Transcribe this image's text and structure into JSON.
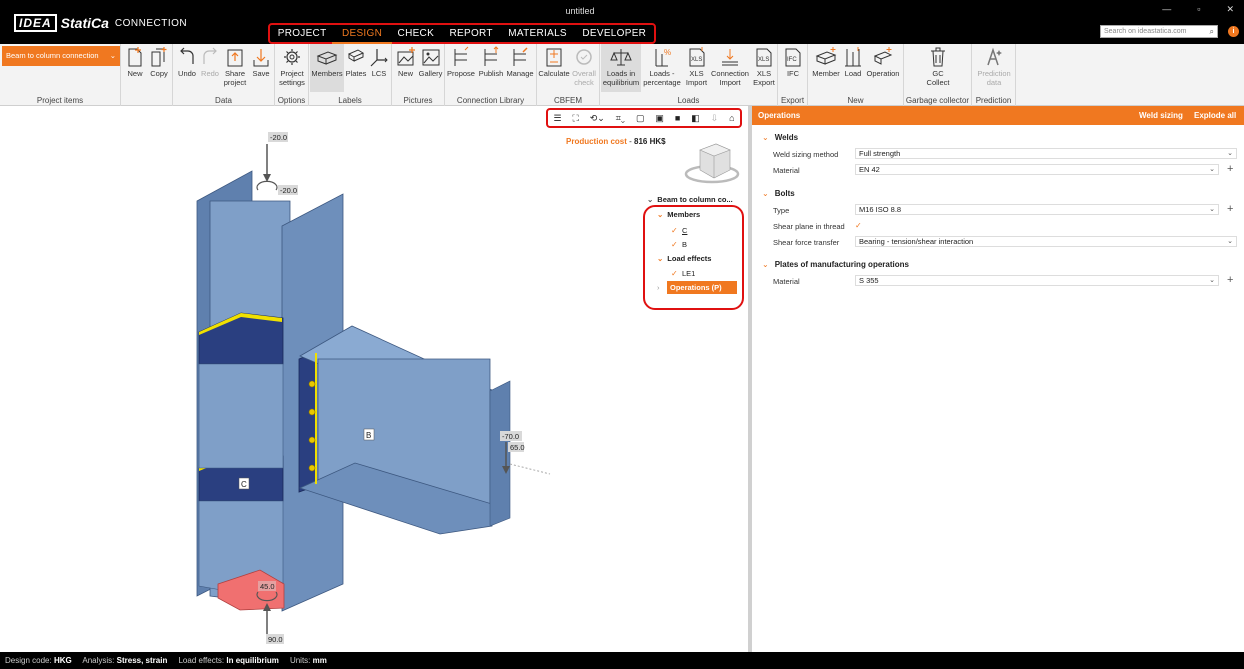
{
  "app": {
    "logo_brand": "IDEA",
    "logo_name": "StatiCa",
    "logo_product": "CONNECTION",
    "window_title": "untitled",
    "window_controls": [
      "—",
      "▫",
      "✕"
    ]
  },
  "menu": [
    "PROJECT",
    "DESIGN",
    "CHECK",
    "REPORT",
    "MATERIALS",
    "DEVELOPER"
  ],
  "menu_active": "DESIGN",
  "search": {
    "placeholder": "Search on ideastatica.com"
  },
  "info_badge": "i",
  "ribbon": {
    "project_dropdown": "Beam to column connection",
    "groups": {
      "project_items": "Project items",
      "data": "Data",
      "options": "Options",
      "labels": "Labels",
      "pictures": "Pictures",
      "connection_library": "Connection Library",
      "cbfem": "CBFEM",
      "loads": "Loads",
      "export": "Export",
      "new": "New",
      "garbage_collector": "Garbage collector",
      "prediction": "Prediction"
    },
    "buttons": {
      "new": "New",
      "copy": "Copy",
      "undo": "Undo",
      "redo": "Redo",
      "share_project_1": "Share",
      "share_project_2": "project",
      "save": "Save",
      "project_settings_1": "Project",
      "project_settings_2": "settings",
      "members": "Members",
      "plates": "Plates",
      "lcs": "LCS",
      "pic_new": "New",
      "gallery": "Gallery",
      "propose": "Propose",
      "publish": "Publish",
      "manage": "Manage",
      "calculate": "Calculate",
      "overall_check_1": "Overall",
      "overall_check_2": "check",
      "loads_in_eq_1": "Loads in",
      "loads_in_eq_2": "equilibrium",
      "loads_pct_1": "Loads -",
      "loads_pct_2": "percentage",
      "xls_import_1": "XLS",
      "xls_import_2": "Import",
      "conn_import_1": "Connection",
      "conn_import_2": "Import",
      "xls_export_1": "XLS",
      "xls_export_2": "Export",
      "ifc": "IFC",
      "member": "Member",
      "load": "Load",
      "operation": "Operation",
      "gc_1": "GC",
      "gc_2": "Collect",
      "prediction_1": "Prediction",
      "prediction_2": "data"
    }
  },
  "viewport": {
    "production_cost_label": "Production cost",
    "production_cost_sep": " - ",
    "production_cost_value": "816 HK$",
    "labels": {
      "top_load": "-20.0",
      "top_moment": "-20.0",
      "right_load": "-70.0",
      "right_moment": "65.0",
      "bottom_moment": "45.0",
      "bottom_load": "90.0",
      "member_b": "B",
      "member_c": "C"
    },
    "tree": {
      "root": "Beam to column co...",
      "members": "Members",
      "member_items": [
        "C",
        "B"
      ],
      "load_effects": "Load effects",
      "load_items": [
        "LE1"
      ],
      "operations": "Operations (P)"
    }
  },
  "panel": {
    "title": "Operations",
    "action_weld_sizing": "Weld sizing",
    "action_explode_all": "Explode all",
    "welds": {
      "title": "Welds",
      "sizing_method_label": "Weld sizing method",
      "sizing_method_value": "Full strength",
      "material_label": "Material",
      "material_value": "EN 42"
    },
    "bolts": {
      "title": "Bolts",
      "type_label": "Type",
      "type_value": "M16 ISO 8.8",
      "shear_plane_label": "Shear plane in thread",
      "shear_plane_checked": true,
      "shear_force_label": "Shear force transfer",
      "shear_force_value": "Bearing - tension/shear interaction"
    },
    "plates": {
      "title": "Plates of manufacturing operations",
      "material_label": "Material",
      "material_value": "S 355"
    }
  },
  "status": {
    "design_code_label": "Design code:",
    "design_code_value": "HKG",
    "analysis_label": "Analysis:",
    "analysis_value": "Stress, strain",
    "load_effects_label": "Load effects:",
    "load_effects_value": "In equilibrium",
    "units_label": "Units:",
    "units_value": "mm"
  },
  "colors": {
    "accent": "#f07820",
    "highlight": "#e01010",
    "steel": "#7f9fc8",
    "steel_dark": "#5a7aa6",
    "stiffener": "#2a3f80",
    "weld": "#f0e000",
    "load_plate": "#f07070"
  }
}
